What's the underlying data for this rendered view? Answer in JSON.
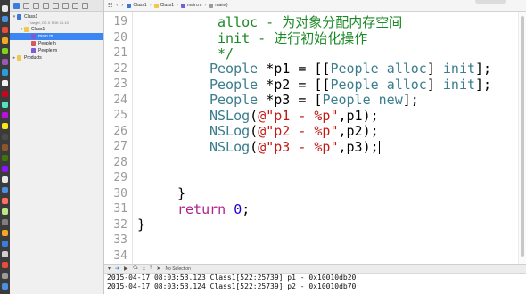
{
  "navigator": {
    "items": [
      {
        "label": "Class1",
        "kind": "project",
        "sub": "1 target, OS X SDK 10.10"
      },
      {
        "label": "Class1",
        "kind": "folder"
      },
      {
        "label": "main.m",
        "kind": "mfile",
        "selected": true
      },
      {
        "label": "People.h",
        "kind": "hfile"
      },
      {
        "label": "People.m",
        "kind": "mfile"
      },
      {
        "label": "Products",
        "kind": "folder"
      }
    ]
  },
  "jumpbar": {
    "crumbs": [
      "Class1",
      "Class1",
      "main.m",
      "main()"
    ]
  },
  "editor": {
    "lines": [
      {
        "num": "19",
        "indent": 10,
        "parts": [
          {
            "t": "alloc - 为对象分配内存空间",
            "c": "cm"
          }
        ]
      },
      {
        "num": "20",
        "indent": 10,
        "parts": [
          {
            "t": "init - 进行初始化操作",
            "c": "cm"
          }
        ]
      },
      {
        "num": "21",
        "indent": 10,
        "parts": [
          {
            "t": "*/",
            "c": "cm"
          }
        ]
      },
      {
        "num": "22",
        "indent": 9,
        "parts": [
          {
            "t": "People",
            "c": "ty"
          },
          {
            "t": " *p1 = [["
          },
          {
            "t": "People",
            "c": "ty"
          },
          {
            "t": " "
          },
          {
            "t": "alloc",
            "c": "ty"
          },
          {
            "t": "] "
          },
          {
            "t": "init",
            "c": "ty"
          },
          {
            "t": "];"
          }
        ]
      },
      {
        "num": "23",
        "indent": 9,
        "parts": [
          {
            "t": "People",
            "c": "ty"
          },
          {
            "t": " *p2 = [["
          },
          {
            "t": "People",
            "c": "ty"
          },
          {
            "t": " "
          },
          {
            "t": "alloc",
            "c": "ty"
          },
          {
            "t": "] "
          },
          {
            "t": "init",
            "c": "ty"
          },
          {
            "t": "];"
          }
        ]
      },
      {
        "num": "24",
        "indent": 9,
        "parts": [
          {
            "t": "People",
            "c": "ty"
          },
          {
            "t": " *p3 = ["
          },
          {
            "t": "People",
            "c": "ty"
          },
          {
            "t": " "
          },
          {
            "t": "new",
            "c": "ty"
          },
          {
            "t": "];"
          }
        ]
      },
      {
        "num": "25",
        "indent": 9,
        "parts": [
          {
            "t": "NSLog",
            "c": "ty"
          },
          {
            "t": "("
          },
          {
            "t": "@\"p1 - %p\"",
            "c": "st"
          },
          {
            "t": ",p1);"
          }
        ]
      },
      {
        "num": "26",
        "indent": 9,
        "parts": [
          {
            "t": "NSLog",
            "c": "ty"
          },
          {
            "t": "("
          },
          {
            "t": "@\"p2 - %p\"",
            "c": "st"
          },
          {
            "t": ",p2);"
          }
        ]
      },
      {
        "num": "27",
        "indent": 9,
        "parts": [
          {
            "t": "NSLog",
            "c": "ty"
          },
          {
            "t": "("
          },
          {
            "t": "@\"p3 - %p\"",
            "c": "st"
          },
          {
            "t": ",p3);"
          }
        ],
        "cursor": true
      },
      {
        "num": "28",
        "indent": 0,
        "parts": []
      },
      {
        "num": "29",
        "indent": 0,
        "parts": []
      },
      {
        "num": "30",
        "indent": 5,
        "parts": [
          {
            "t": "}"
          }
        ]
      },
      {
        "num": "31",
        "indent": 5,
        "parts": [
          {
            "t": "return",
            "c": "kw"
          },
          {
            "t": " "
          },
          {
            "t": "0",
            "c": "nu"
          },
          {
            "t": ";"
          }
        ]
      },
      {
        "num": "32",
        "indent": 0,
        "parts": [
          {
            "t": "}"
          }
        ]
      },
      {
        "num": "33",
        "indent": 0,
        "parts": []
      },
      {
        "num": "34",
        "indent": 0,
        "parts": []
      }
    ]
  },
  "debug": {
    "selection_label": "No Selection"
  },
  "console": {
    "lines": [
      "2015-04-17 08:03:53.123 Class1[522:25739] p1 - 0x10010db20",
      "2015-04-17 08:03:53.124 Class1[522:25739] p2 - 0x10010db70"
    ]
  },
  "colors": {
    "comment": "#1b8a25",
    "type": "#3a7d8c",
    "keyword": "#b0218a",
    "string": "#c41a16",
    "number": "#1c00cf",
    "selection": "#3c85f4"
  }
}
